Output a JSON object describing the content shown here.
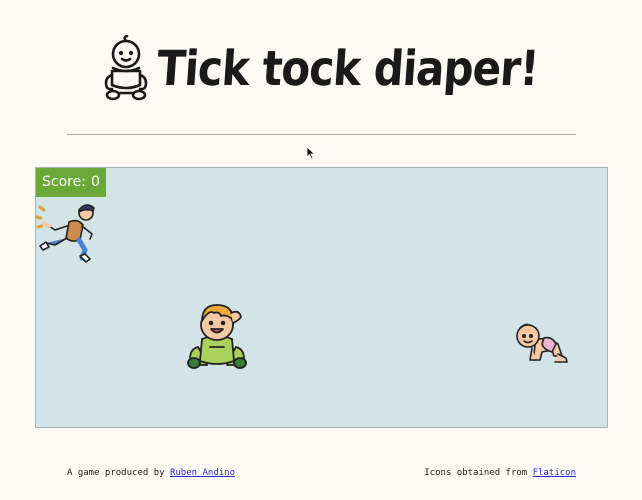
{
  "header": {
    "title": "Tick tock diaper!",
    "logo_icon": "baby-diaper-icon"
  },
  "game": {
    "score_label": "Score:",
    "score_value": "0",
    "background_color": "#d3e4e6",
    "score_color": "#6aa83a",
    "sprites": [
      "running-parent-icon",
      "sitting-baby-icon",
      "crawling-baby-icon"
    ]
  },
  "footer": {
    "credit_prefix": "A game produced by",
    "credit_link": "Ruben Andino",
    "icons_prefix": "Icons obtained from",
    "icons_link": "Flaticon"
  }
}
